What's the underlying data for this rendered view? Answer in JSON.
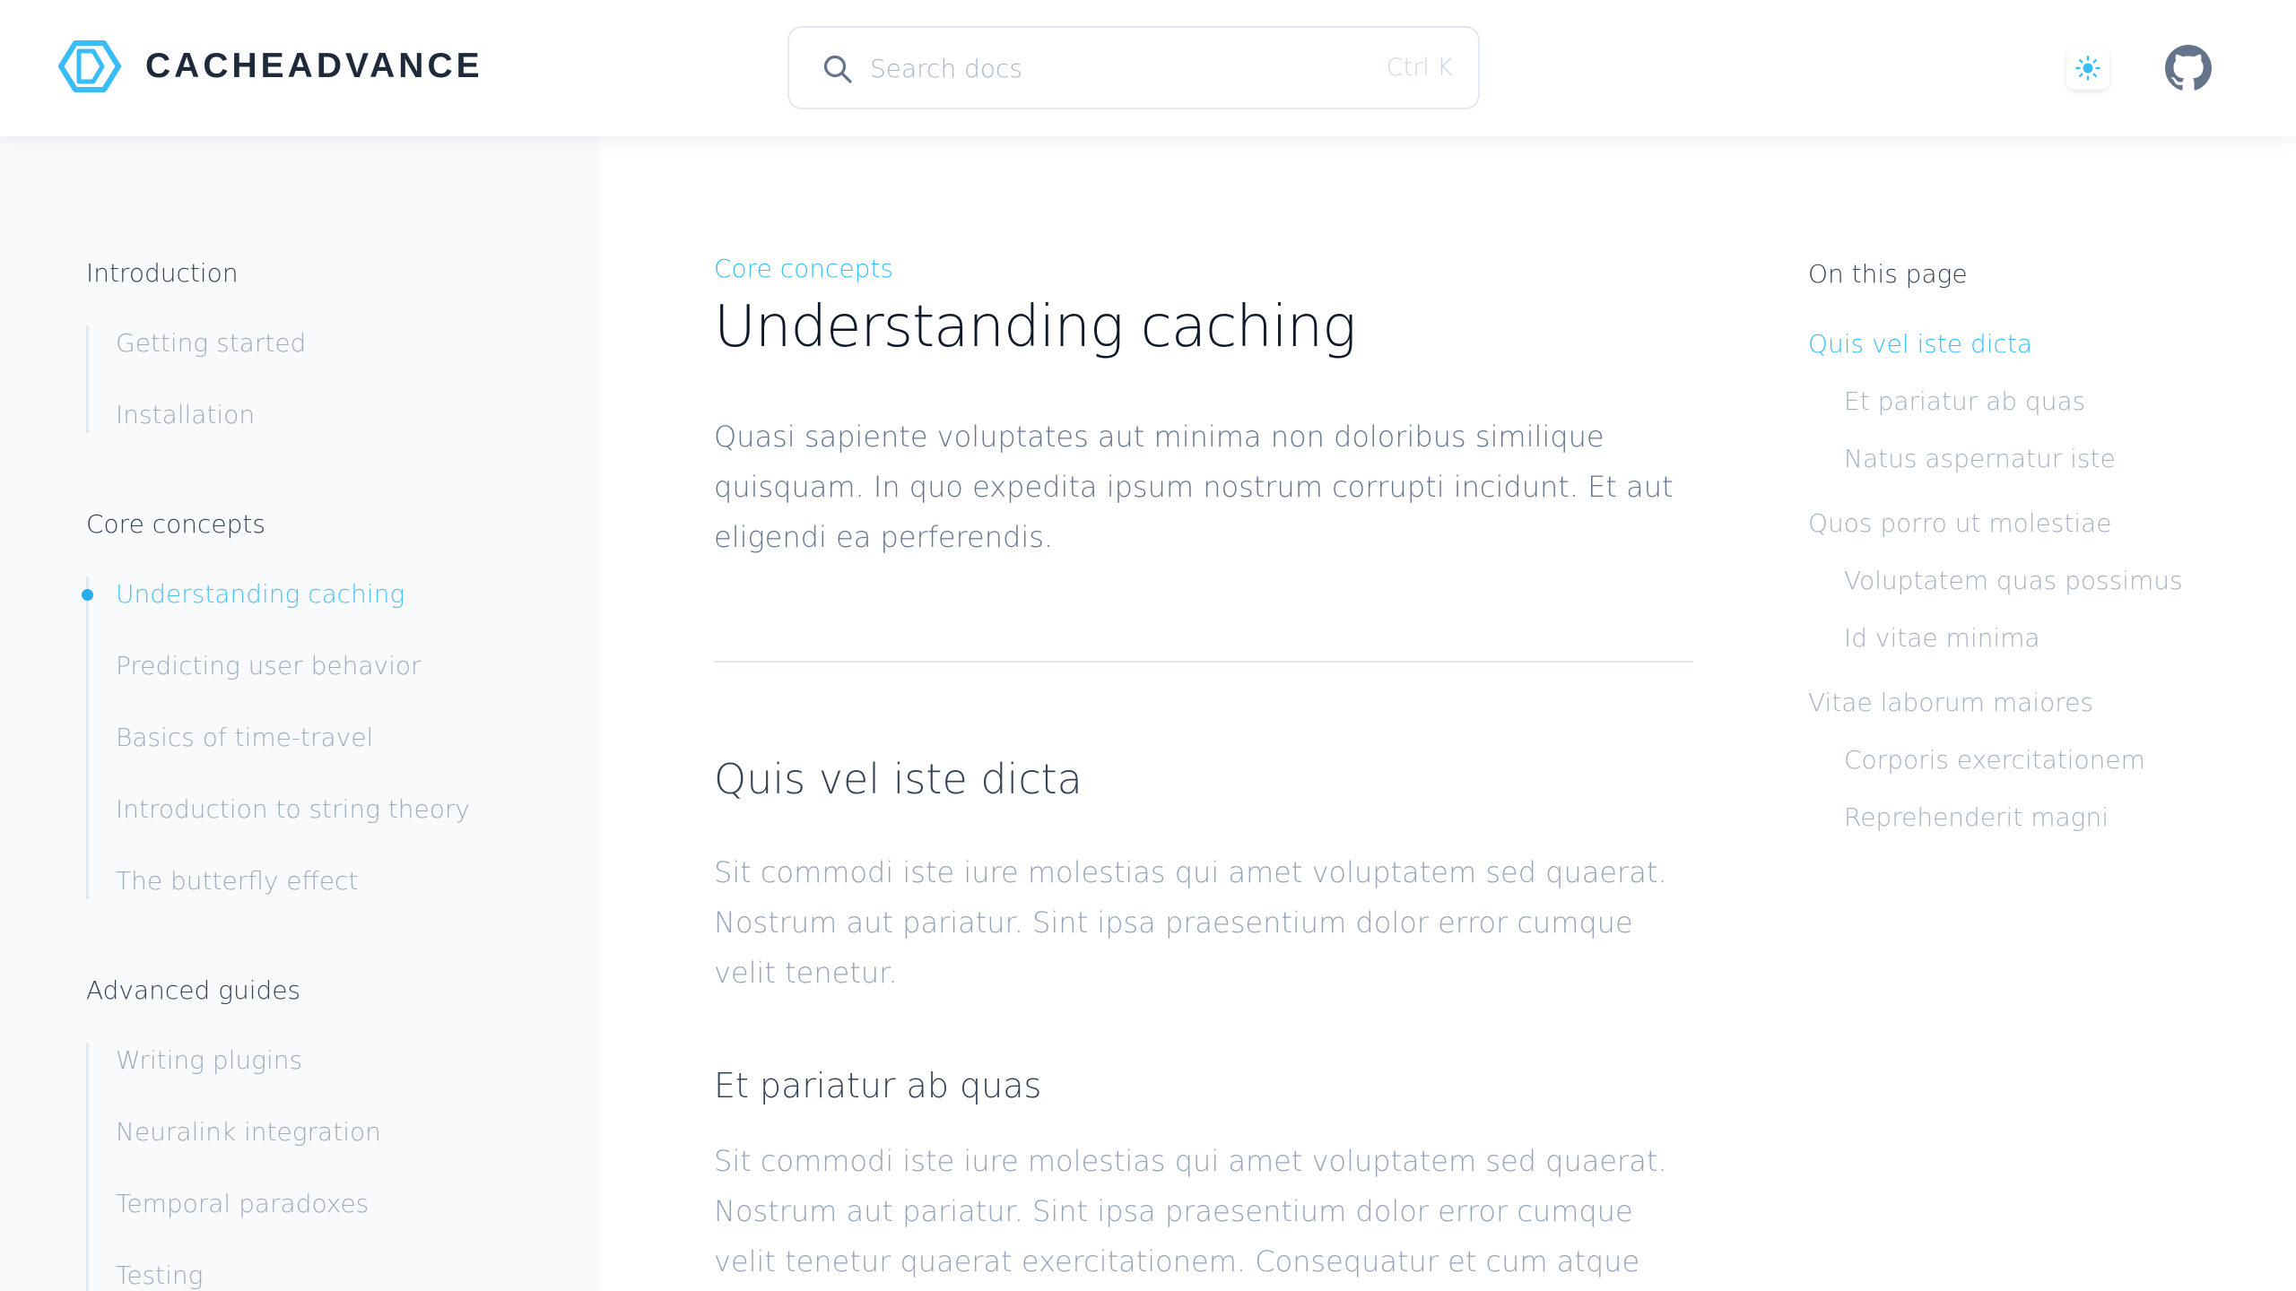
{
  "brand": {
    "name": "CACHEADVANCE",
    "logo_icon": "hexagon-cube-logo",
    "accent": "#38bdf8"
  },
  "search": {
    "placeholder": "Search docs",
    "shortcut": "Ctrl K"
  },
  "header": {
    "theme_icon": "sun-icon",
    "repo_icon": "github-icon"
  },
  "sidebar": {
    "groups": [
      {
        "title": "Introduction",
        "items": [
          "Getting started",
          "Installation"
        ]
      },
      {
        "title": "Core concepts",
        "items": [
          "Understanding caching",
          "Predicting user behavior",
          "Basics of time-travel",
          "Introduction to string theory",
          "The butterfly effect"
        ]
      },
      {
        "title": "Advanced guides",
        "items": [
          "Writing plugins",
          "Neuralink integration",
          "Temporal paradoxes",
          "Testing"
        ]
      }
    ],
    "active_item": "Understanding caching"
  },
  "article": {
    "section": "Core concepts",
    "title": "Understanding caching",
    "lead": "Quasi sapiente voluptates aut minima non doloribus similique quisquam. In quo expedita ipsum nostrum corrupti incidunt. Et aut eligendi ea perferendis.",
    "h2": "Quis vel iste dicta",
    "p1": "Sit commodi iste iure molestias qui amet voluptatem sed quaerat. Nostrum aut pariatur. Sint ipsa praesentium dolor error cumque velit tenetur.",
    "h3": "Et pariatur ab quas",
    "p2": "Sit commodi iste iure molestias qui amet voluptatem sed quaerat. Nostrum aut pariatur. Sint ipsa praesentium dolor error cumque velit tenetur quaerat exercitationem. Consequatur et cum atque mollitia qui quia necessitatibus."
  },
  "toc": {
    "title": "On this page",
    "items": [
      {
        "label": "Quis vel iste dicta",
        "level": 1
      },
      {
        "label": "Et pariatur ab quas",
        "level": 2
      },
      {
        "label": "Natus aspernatur iste",
        "level": 2
      },
      {
        "label": "Quos porro ut molestiae",
        "level": 1
      },
      {
        "label": "Voluptatem quas possimus",
        "level": 2
      },
      {
        "label": "Id vitae minima",
        "level": 2
      },
      {
        "label": "Vitae laborum maiores",
        "level": 1
      },
      {
        "label": "Corporis exercitationem",
        "level": 2
      },
      {
        "label": "Reprehenderit magni",
        "level": 2
      }
    ],
    "active_item": "Quis vel iste dicta"
  }
}
